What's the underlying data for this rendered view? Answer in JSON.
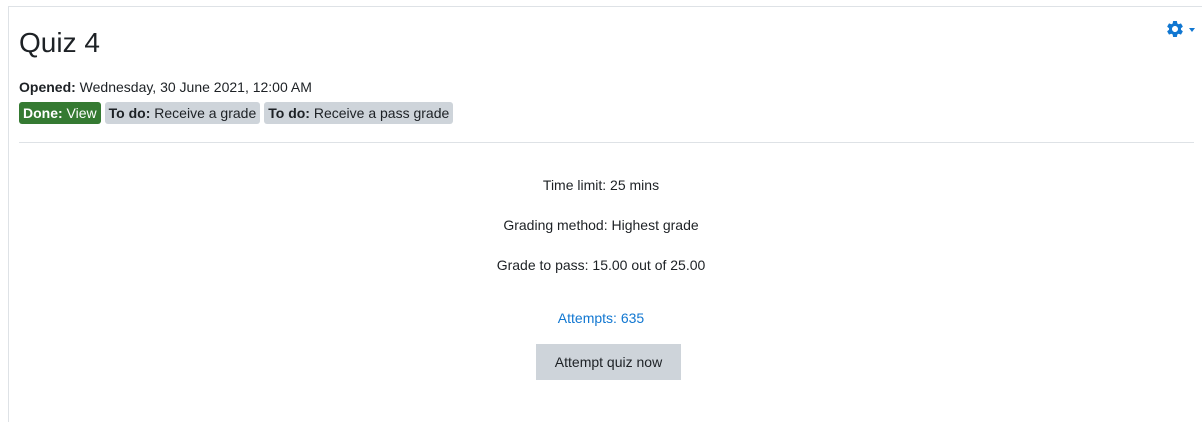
{
  "activity": {
    "title": "Quiz 4"
  },
  "dates": {
    "opened_label": "Opened:",
    "opened_value": " Wednesday, 30 June 2021, 12:00 AM"
  },
  "completion": [
    {
      "state_label": "Done:",
      "text": " View",
      "status": "done",
      "color": "#357a32"
    },
    {
      "state_label": "To do:",
      "text": " Receive a grade",
      "status": "todo",
      "color": "#ced4da"
    },
    {
      "state_label": "To do:",
      "text": " Receive a pass grade",
      "status": "todo",
      "color": "#ced4da"
    }
  ],
  "quiz_info": {
    "time_limit": "Time limit: 25 mins",
    "grading_method": "Grading method: Highest grade",
    "grade_to_pass": "Grade to pass: 15.00 out of 25.00"
  },
  "attempts_link": "Attempts: 635",
  "attempt_button": "Attempt quiz now",
  "icons": {
    "settings": "gear-icon",
    "settings_caret": "caret-down-icon"
  },
  "colors": {
    "link": "#1177d1",
    "done_badge": "#357a32",
    "todo_badge": "#ced4da",
    "button": "#ced4da"
  }
}
